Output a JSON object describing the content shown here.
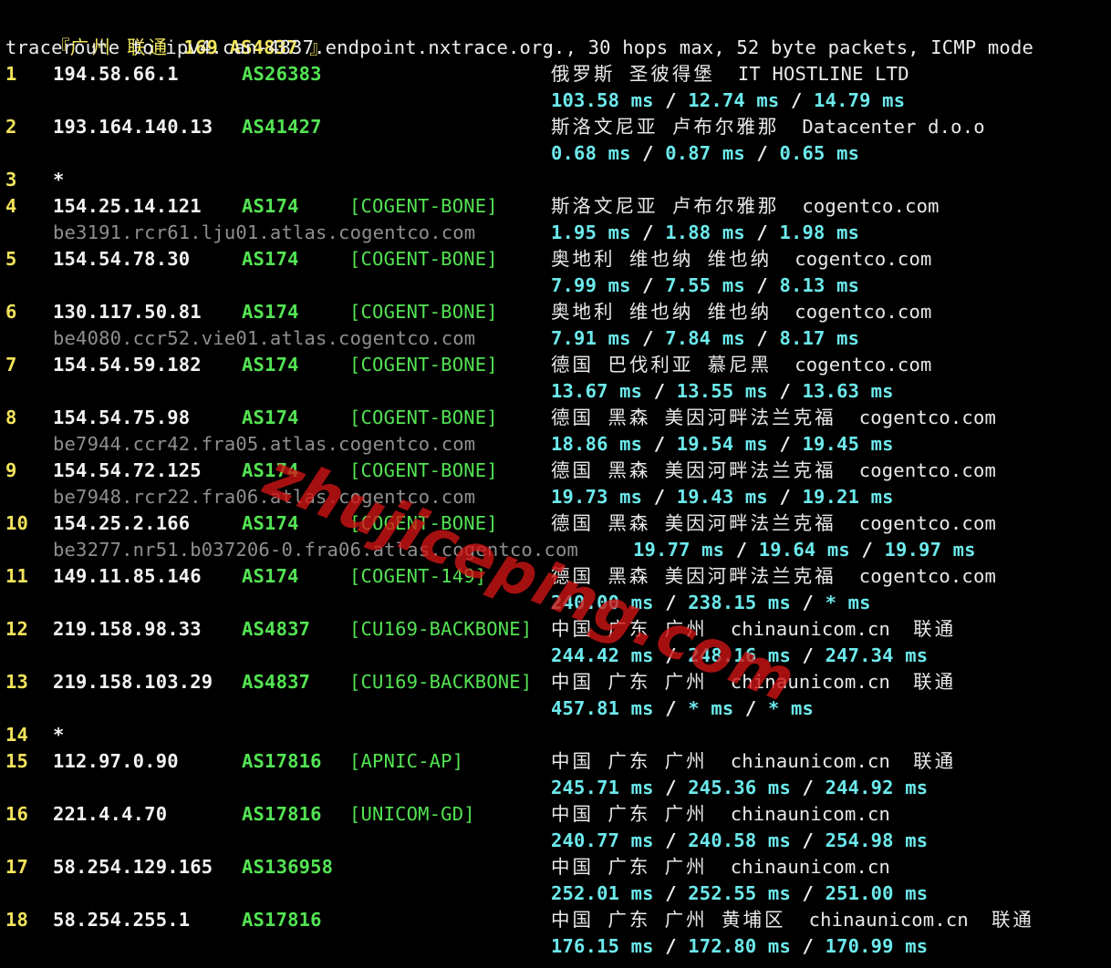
{
  "header": {
    "bracket_open": "『",
    "city": "广州 联通 ",
    "route": "169 AS4837",
    "bracket_close": " 』"
  },
  "command": "traceroute to ipv4.can-4837.endpoint.nxtrace.org., 30 hops max, 52 byte packets, ICMP mode",
  "separator": " / ",
  "watermark": "zhujiceping.com",
  "hops": [
    {
      "hop": "1",
      "ip": "194.58.66.1",
      "asn": "AS26383",
      "tag": "",
      "geo": "俄罗斯 圣彼得堡",
      "org": "IT HOSTLINE LTD",
      "rdns": "",
      "rtt": [
        "103.58 ms",
        "12.74 ms",
        "14.79 ms"
      ]
    },
    {
      "hop": "2",
      "ip": "193.164.140.13",
      "asn": "AS41427",
      "tag": "",
      "geo": "斯洛文尼亚 卢布尔雅那",
      "org": "Datacenter d.o.o",
      "rdns": "",
      "rtt": [
        "0.68 ms",
        "0.87 ms",
        "0.65 ms"
      ]
    },
    {
      "hop": "3",
      "star": "*"
    },
    {
      "hop": "4",
      "ip": "154.25.14.121",
      "asn": "AS174",
      "tag": "[COGENT-BONE]",
      "geo": "斯洛文尼亚 卢布尔雅那",
      "org": "cogentco.com",
      "rdns": "be3191.rcr61.lju01.atlas.cogentco.com",
      "rtt": [
        "1.95 ms",
        "1.88 ms",
        "1.98 ms"
      ]
    },
    {
      "hop": "5",
      "ip": "154.54.78.30",
      "asn": "AS174",
      "tag": "[COGENT-BONE]",
      "geo": "奥地利 维也纳 维也纳",
      "org": "cogentco.com",
      "rdns": "",
      "rtt": [
        "7.99 ms",
        "7.55 ms",
        "8.13 ms"
      ]
    },
    {
      "hop": "6",
      "ip": "130.117.50.81",
      "asn": "AS174",
      "tag": "[COGENT-BONE]",
      "geo": "奥地利 维也纳 维也纳",
      "org": "cogentco.com",
      "rdns": "be4080.ccr52.vie01.atlas.cogentco.com",
      "rtt": [
        "7.91 ms",
        "7.84 ms",
        "8.17 ms"
      ]
    },
    {
      "hop": "7",
      "ip": "154.54.59.182",
      "asn": "AS174",
      "tag": "[COGENT-BONE]",
      "geo": "德国 巴伐利亚 慕尼黑",
      "org": "cogentco.com",
      "rdns": "",
      "rtt": [
        "13.67 ms",
        "13.55 ms",
        "13.63 ms"
      ]
    },
    {
      "hop": "8",
      "ip": "154.54.75.98",
      "asn": "AS174",
      "tag": "[COGENT-BONE]",
      "geo": "德国 黑森 美因河畔法兰克福",
      "org": "cogentco.com",
      "rdns": "be7944.ccr42.fra05.atlas.cogentco.com",
      "rtt": [
        "18.86 ms",
        "19.54 ms",
        "19.45 ms"
      ]
    },
    {
      "hop": "9",
      "ip": "154.54.72.125",
      "asn": "AS174",
      "tag": "[COGENT-BONE]",
      "geo": "德国 黑森 美因河畔法兰克福",
      "org": "cogentco.com",
      "rdns": "be7948.rcr22.fra06.atlas.cogentco.com",
      "rtt": [
        "19.73 ms",
        "19.43 ms",
        "19.21 ms"
      ]
    },
    {
      "hop": "10",
      "ip": "154.25.2.166",
      "asn": "AS174",
      "tag": "[COGENT-BONE]",
      "geo": "德国 黑森 美因河畔法兰克福",
      "org": "cogentco.com",
      "rdns": "be3277.nr51.b037206-0.fra06.atlas.cogentco.com",
      "rtt_wide": true,
      "rtt": [
        "19.77 ms",
        "19.64 ms",
        "19.97 ms"
      ]
    },
    {
      "hop": "11",
      "ip": "149.11.85.146",
      "asn": "AS174",
      "tag": "[COGENT-149]",
      "geo": "德国 黑森 美因河畔法兰克福",
      "org": "cogentco.com",
      "rdns": "",
      "rtt": [
        "240.00 ms",
        "238.15 ms",
        "* ms"
      ]
    },
    {
      "hop": "12",
      "ip": "219.158.98.33",
      "asn": "AS4837",
      "tag": "[CU169-BACKBONE]",
      "geo": "中国 广东 广州",
      "org": "chinaunicom.cn",
      "isp": "联通",
      "rdns": "",
      "rtt": [
        "244.42 ms",
        "248.16 ms",
        "247.34 ms"
      ]
    },
    {
      "hop": "13",
      "ip": "219.158.103.29",
      "asn": "AS4837",
      "tag": "[CU169-BACKBONE]",
      "geo": "中国 广东 广州",
      "org": "chinaunicom.cn",
      "isp": "联通",
      "rdns": "",
      "rtt": [
        "457.81 ms",
        "* ms",
        "* ms"
      ]
    },
    {
      "hop": "14",
      "star": "*"
    },
    {
      "hop": "15",
      "ip": "112.97.0.90",
      "asn": "AS17816",
      "tag": "[APNIC-AP]",
      "geo": "中国 广东 广州",
      "org": "chinaunicom.cn",
      "isp": "联通",
      "rdns": "",
      "rtt": [
        "245.71 ms",
        "245.36 ms",
        "244.92 ms"
      ]
    },
    {
      "hop": "16",
      "ip": "221.4.4.70",
      "asn": "AS17816",
      "tag": "[UNICOM-GD]",
      "geo": "中国 广东 广州",
      "org": "chinaunicom.cn",
      "rdns": "",
      "rtt": [
        "240.77 ms",
        "240.58 ms",
        "254.98 ms"
      ]
    },
    {
      "hop": "17",
      "ip": "58.254.129.165",
      "asn": "AS136958",
      "tag": "",
      "geo": "中国 广东 广州",
      "org": "chinaunicom.cn",
      "rdns": "",
      "rtt": [
        "252.01 ms",
        "252.55 ms",
        "251.00 ms"
      ]
    },
    {
      "hop": "18",
      "ip": "58.254.255.1",
      "asn": "AS17816",
      "tag": "",
      "geo": "中国 广东 广州 黄埔区",
      "org": "chinaunicom.cn",
      "isp": "联通",
      "rdns": "",
      "rtt": [
        "176.15 ms",
        "172.80 ms",
        "170.99 ms"
      ]
    }
  ]
}
